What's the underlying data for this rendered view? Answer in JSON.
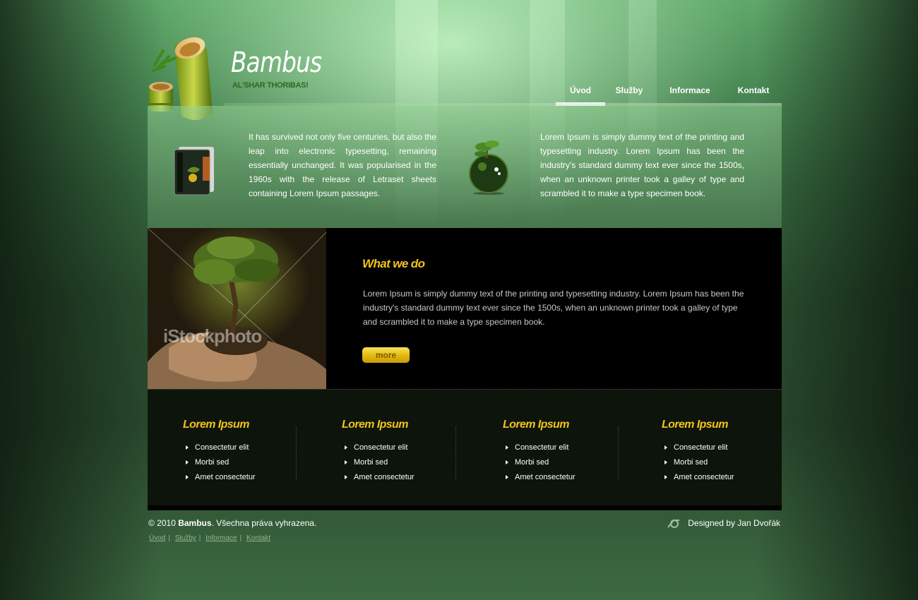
{
  "header": {
    "brand": "Bambus",
    "tagline": "AL'SHAR THORIBAS!"
  },
  "nav": {
    "items": [
      "Úvod",
      "Služby",
      "Informace",
      "Kontakt"
    ],
    "active": "Úvod"
  },
  "features": {
    "left_text": "It has survived not only five centuries, but also the leap into electronic typesetting, remaining essentially unchanged. It was popularised in the 1960s with the release of Letraset sheets containing Lorem Ipsum passages.",
    "right_text": "Lorem Ipsum is simply dummy text of the printing and typesetting industry. Lorem Ipsum has been the industry's standard dummy text ever since the 1500s, when an unknown printer took a galley of type and scrambled it to make a type specimen book."
  },
  "what_we_do": {
    "title": "What we do",
    "body": "Lorem Ipsum is simply dummy text of the printing and typesetting industry. Lorem Ipsum has been the industry's standard dummy text ever since the 1500s, when an unknown printer took a galley of type and scrambled it to make a type specimen book.",
    "more_label": "more",
    "photo_watermark": "iStockphoto"
  },
  "columns": [
    {
      "title": "Lorem Ipsum",
      "links": [
        "Consectetur elit",
        "Morbi sed",
        "Amet consectetur"
      ]
    },
    {
      "title": "Lorem Ipsum",
      "links": [
        "Consectetur elit",
        "Morbi sed",
        "Amet consectetur"
      ]
    },
    {
      "title": "Lorem Ipsum",
      "links": [
        "Consectetur elit",
        "Morbi sed",
        "Amet consectetur"
      ]
    },
    {
      "title": "Lorem Ipsum",
      "links": [
        "Consectetur elit",
        "Morbi sed",
        "Amet consectetur"
      ]
    }
  ],
  "footer": {
    "copyright_prefix": "© 2010 ",
    "copyright_brand": "Bambus",
    "copyright_suffix": ". Všechna práva vyhrazena.",
    "links": [
      "Úvod",
      "Služby",
      "Informace",
      "Kontakt"
    ],
    "designer": "Designed by Jan Dvořák"
  },
  "colors": {
    "accent_yellow": "#f2c21c",
    "brand_green": "#2d6a1e",
    "panel_black": "#000000"
  }
}
